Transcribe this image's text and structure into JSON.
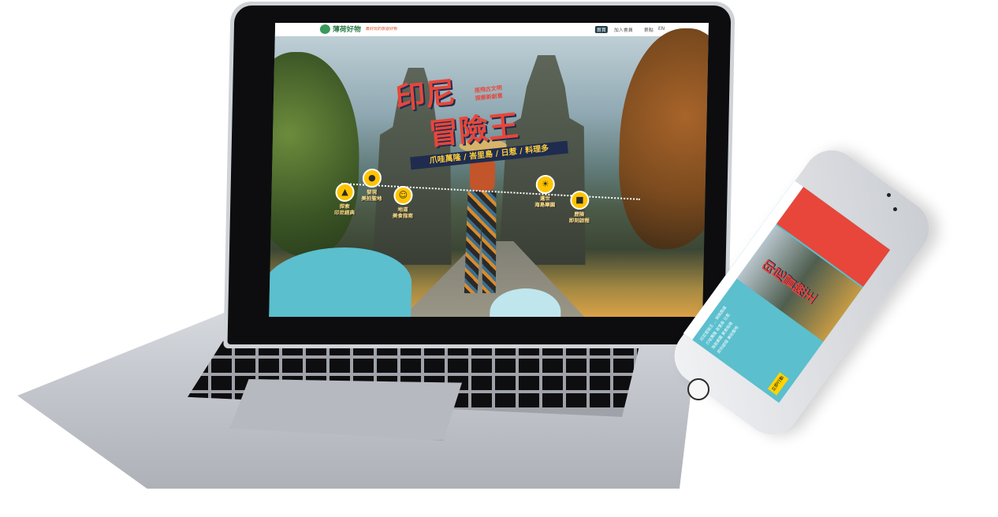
{
  "site": {
    "logo_text": "薄荷好物",
    "logo_tagline": "最好玩的旅遊好物",
    "nav": [
      "首頁",
      "加入會員",
      "景點",
      "EN"
    ]
  },
  "hero": {
    "title_line1": "印尼",
    "title_line2": "冒險王",
    "slogan": "搭飛古文明\n探索新創意",
    "subtitle": "爪哇萬隆 / 峇里島 / 日惹 / 料理多"
  },
  "features": [
    {
      "icon": "temple-icon",
      "label": "探索\n印尼經典"
    },
    {
      "icon": "camera-icon",
      "label": "發現\n美拍聖地"
    },
    {
      "icon": "food-icon",
      "label": "地道\n美食指南"
    },
    {
      "icon": "island-icon",
      "label": "遺世\n海島樂園"
    },
    {
      "icon": "ticket-icon",
      "label": "歷險\n即刻啟程"
    }
  ],
  "phone": {
    "title": "印尼冒險王",
    "body": "印尼冒險王 ... 探險路線\n爪哇萬隆 峇里島 日惹\n海島樂園 美食指南\n即刻啟程 美拍聖地",
    "button": "立即行動"
  },
  "colors": {
    "accent_red": "#e8463a",
    "navy": "#1f2c4f",
    "teal": "#5bbfce",
    "yellow": "#ffc400"
  }
}
